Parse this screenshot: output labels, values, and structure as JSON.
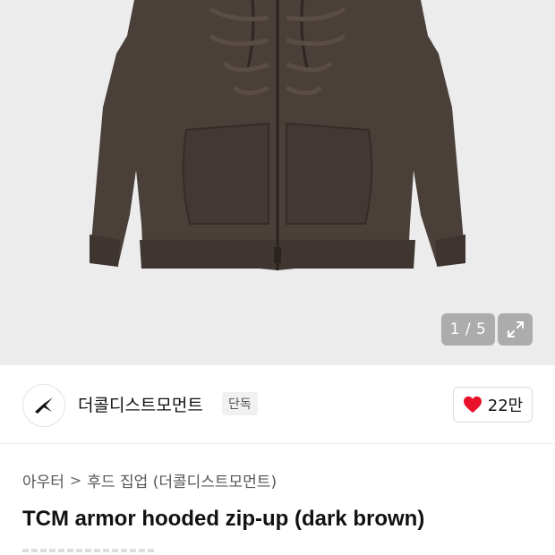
{
  "gallery": {
    "image_alt": "dark brown hooded zip-up",
    "current": "1",
    "total": "5",
    "counter_text": "1 / 5",
    "background": "#ececec",
    "garment_color": "#4a3f39"
  },
  "brand": {
    "name": "더콜디스트모먼트",
    "badge": "단독",
    "likes": "22만",
    "heart_color": "#e8122b"
  },
  "breadcrumb": {
    "category": "아우터",
    "separator": ">",
    "subcategory": "후드 집업 (더콜디스트모먼트)"
  },
  "product": {
    "title": "TCM armor hooded zip-up (dark brown)"
  }
}
